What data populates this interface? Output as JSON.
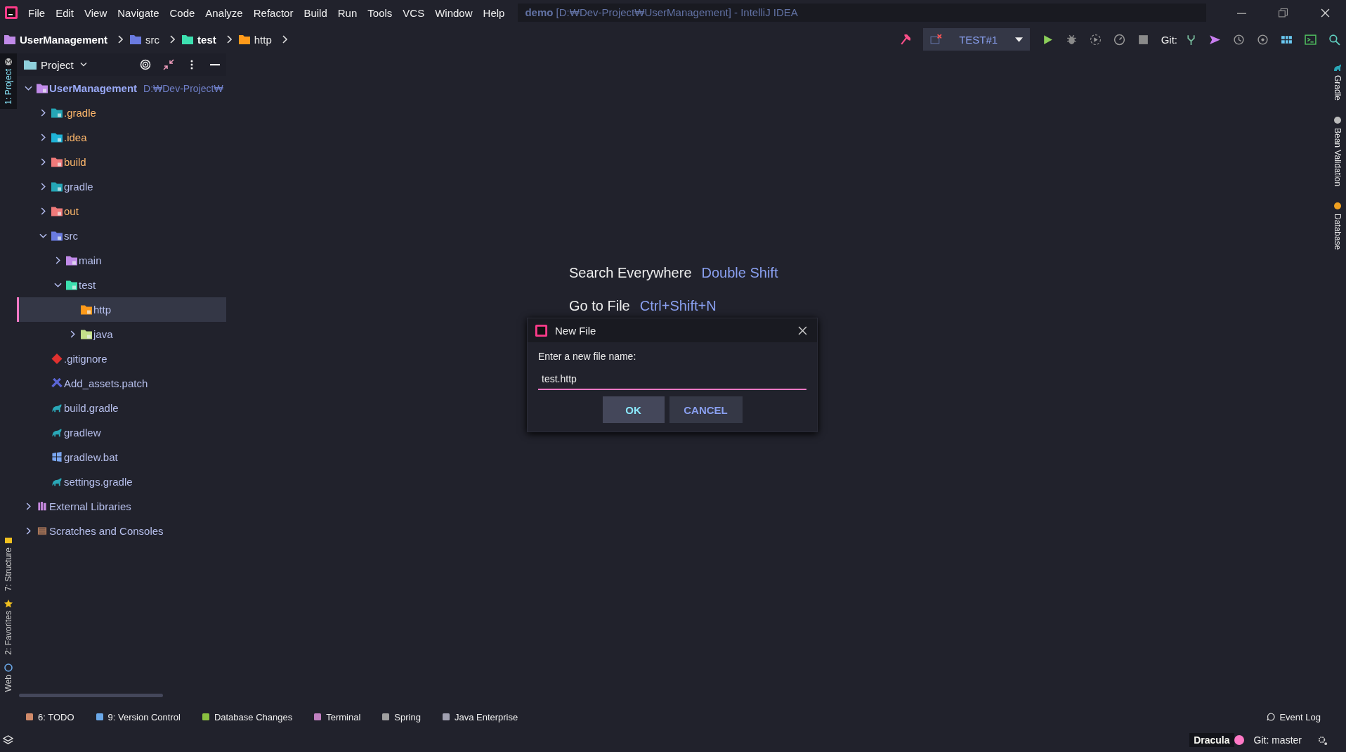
{
  "menu": [
    "File",
    "Edit",
    "View",
    "Navigate",
    "Code",
    "Analyze",
    "Refactor",
    "Build",
    "Run",
    "Tools",
    "VCS",
    "Window",
    "Help"
  ],
  "window": {
    "project": "demo",
    "title": "[D:₩Dev-Project₩UserManagement] - IntelliJ IDEA"
  },
  "breadcrumbs": [
    {
      "label": "UserManagement",
      "kind": "module",
      "emphasized": true
    },
    {
      "label": "src",
      "kind": "source",
      "emphasized": false
    },
    {
      "label": "test",
      "kind": "test",
      "emphasized": true
    },
    {
      "label": "http",
      "kind": "resource",
      "emphasized": false
    }
  ],
  "toolbar": {
    "run_config": "TEST#1",
    "git_label": "Git:"
  },
  "left_strip": {
    "top": [
      {
        "label": "1: Project",
        "kind": "project",
        "selected": true
      }
    ],
    "bottom": [
      {
        "label": "7: Structure",
        "kind": "structure",
        "selected": false
      },
      {
        "label": "2: Favorites",
        "kind": "favorites",
        "selected": false
      },
      {
        "label": "Web",
        "kind": "web",
        "selected": false
      }
    ]
  },
  "right_strip": [
    {
      "label": "Gradle",
      "kind": "gradle"
    },
    {
      "label": "Bean Validation",
      "kind": "bean"
    },
    {
      "label": "Database",
      "kind": "database"
    }
  ],
  "project_panel": {
    "title": "Project",
    "tree": [
      {
        "label": "UserManagement",
        "path": "D:₩Dev-Project₩",
        "kind": "module",
        "ignored": false,
        "selected": false,
        "expanded": true,
        "children": [
          {
            "label": ".gradle",
            "kind": "gradle-folder",
            "ignored": true,
            "selected": false,
            "expanded": false
          },
          {
            "label": ".idea",
            "kind": "idea-folder",
            "ignored": true,
            "selected": false,
            "expanded": false
          },
          {
            "label": "build",
            "kind": "build-folder",
            "ignored": true,
            "selected": false,
            "expanded": false
          },
          {
            "label": "gradle",
            "kind": "gradle-folder",
            "ignored": false,
            "selected": false,
            "expanded": false
          },
          {
            "label": "out",
            "kind": "build-folder",
            "ignored": true,
            "selected": false,
            "expanded": false
          },
          {
            "label": "src",
            "kind": "source",
            "ignored": false,
            "selected": false,
            "expanded": true,
            "children": [
              {
                "label": "main",
                "kind": "module",
                "ignored": false,
                "selected": false,
                "expanded": false
              },
              {
                "label": "test",
                "kind": "test",
                "ignored": false,
                "selected": false,
                "expanded": true,
                "children": [
                  {
                    "label": "http",
                    "kind": "resource",
                    "ignored": false,
                    "selected": true
                  },
                  {
                    "label": "java",
                    "kind": "folder",
                    "ignored": false,
                    "selected": false,
                    "expanded": false
                  }
                ]
              }
            ]
          },
          {
            "label": ".gitignore",
            "kind": "git",
            "ignored": false,
            "selected": false
          },
          {
            "label": "Add_assets.patch",
            "kind": "patch",
            "ignored": false,
            "selected": false
          },
          {
            "label": "build.gradle",
            "kind": "gradle",
            "ignored": false,
            "selected": false
          },
          {
            "label": "gradlew",
            "kind": "gradle",
            "ignored": false,
            "selected": false
          },
          {
            "label": "gradlew.bat",
            "kind": "windows",
            "ignored": false,
            "selected": false
          },
          {
            "label": "settings.gradle",
            "kind": "gradle",
            "ignored": false,
            "selected": false
          }
        ]
      },
      {
        "label": "External Libraries",
        "kind": "library",
        "ignored": false,
        "selected": false,
        "expanded": false
      },
      {
        "label": "Scratches and Consoles",
        "kind": "scratches",
        "ignored": false,
        "selected": false,
        "expanded": false
      }
    ]
  },
  "editor_hints": [
    {
      "action": "Search Everywhere",
      "shortcut": "Double Shift"
    },
    {
      "action": "Go to File",
      "shortcut": "Ctrl+Shift+N"
    }
  ],
  "dialog": {
    "title": "New File",
    "prompt": "Enter a new file name:",
    "value": "test.http",
    "buttons": [
      {
        "label": "OK",
        "default": true
      },
      {
        "label": "CANCEL",
        "default": false
      }
    ]
  },
  "bottom_tools": [
    {
      "label": "6: TODO",
      "kind": "todo"
    },
    {
      "label": "9: Version Control",
      "kind": "vcs"
    },
    {
      "label": "Database Changes",
      "kind": "db"
    },
    {
      "label": "Terminal",
      "kind": "terminal"
    },
    {
      "label": "Spring",
      "kind": "spring"
    },
    {
      "label": "Java Enterprise",
      "kind": "javaee"
    }
  ],
  "event_log": "Event Log",
  "status": {
    "theme": "Dracula",
    "vcs": "Git: master"
  }
}
